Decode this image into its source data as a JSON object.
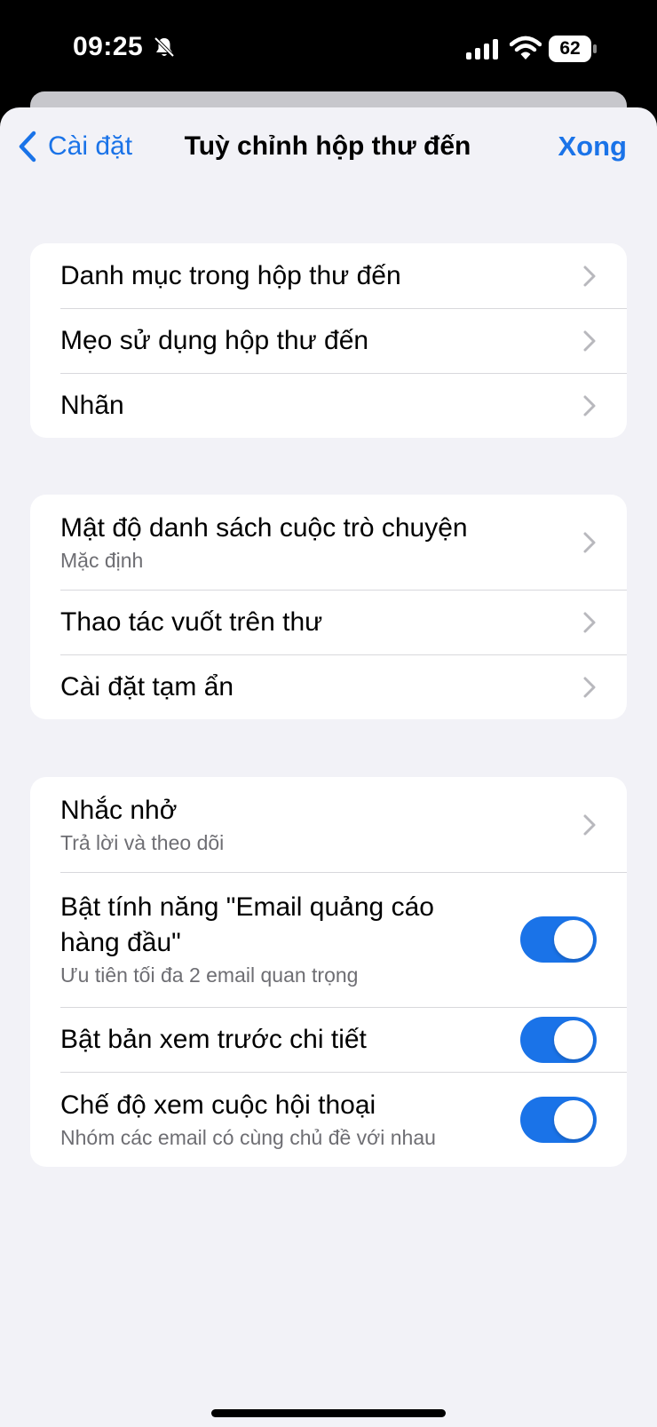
{
  "status_bar": {
    "time": "09:25",
    "battery": "62",
    "icons": [
      "bell-slash-icon",
      "cellular-signal-icon",
      "wifi-icon",
      "battery-icon"
    ]
  },
  "nav": {
    "back_label": "Cài đặt",
    "title": "Tuỳ chỉnh hộp thư đến",
    "done_label": "Xong"
  },
  "colors": {
    "accent": "#1a73e8",
    "background": "#f2f2f7",
    "card": "#ffffff",
    "secondary_text": "#6e6e73"
  },
  "groups": [
    {
      "rows": [
        {
          "label": "Danh mục trong hộp thư đến",
          "accessory": "chevron"
        },
        {
          "label": "Mẹo sử dụng hộp thư đến",
          "accessory": "chevron"
        },
        {
          "label": "Nhãn",
          "accessory": "chevron"
        }
      ]
    },
    {
      "rows": [
        {
          "label": "Mật độ danh sách cuộc trò chuyện",
          "subtitle": "Mặc định",
          "accessory": "chevron"
        },
        {
          "label": "Thao tác vuốt trên thư",
          "accessory": "chevron"
        },
        {
          "label": "Cài đặt tạm ẩn",
          "accessory": "chevron"
        }
      ]
    },
    {
      "rows": [
        {
          "label": "Nhắc nhở",
          "subtitle": "Trả lời và theo dõi",
          "accessory": "chevron"
        },
        {
          "label_line1": "Bật tính năng \"Email quảng cáo",
          "label_line2": "hàng đầu\"",
          "subtitle": "Ưu tiên tối đa 2 email quan trọng",
          "accessory": "toggle",
          "enabled": true
        },
        {
          "label": "Bật bản xem trước chi tiết",
          "accessory": "toggle",
          "enabled": true
        },
        {
          "label": "Chế độ xem cuộc hội thoại",
          "subtitle": "Nhóm các email có cùng chủ đề với nhau",
          "accessory": "toggle",
          "enabled": true
        }
      ]
    }
  ]
}
